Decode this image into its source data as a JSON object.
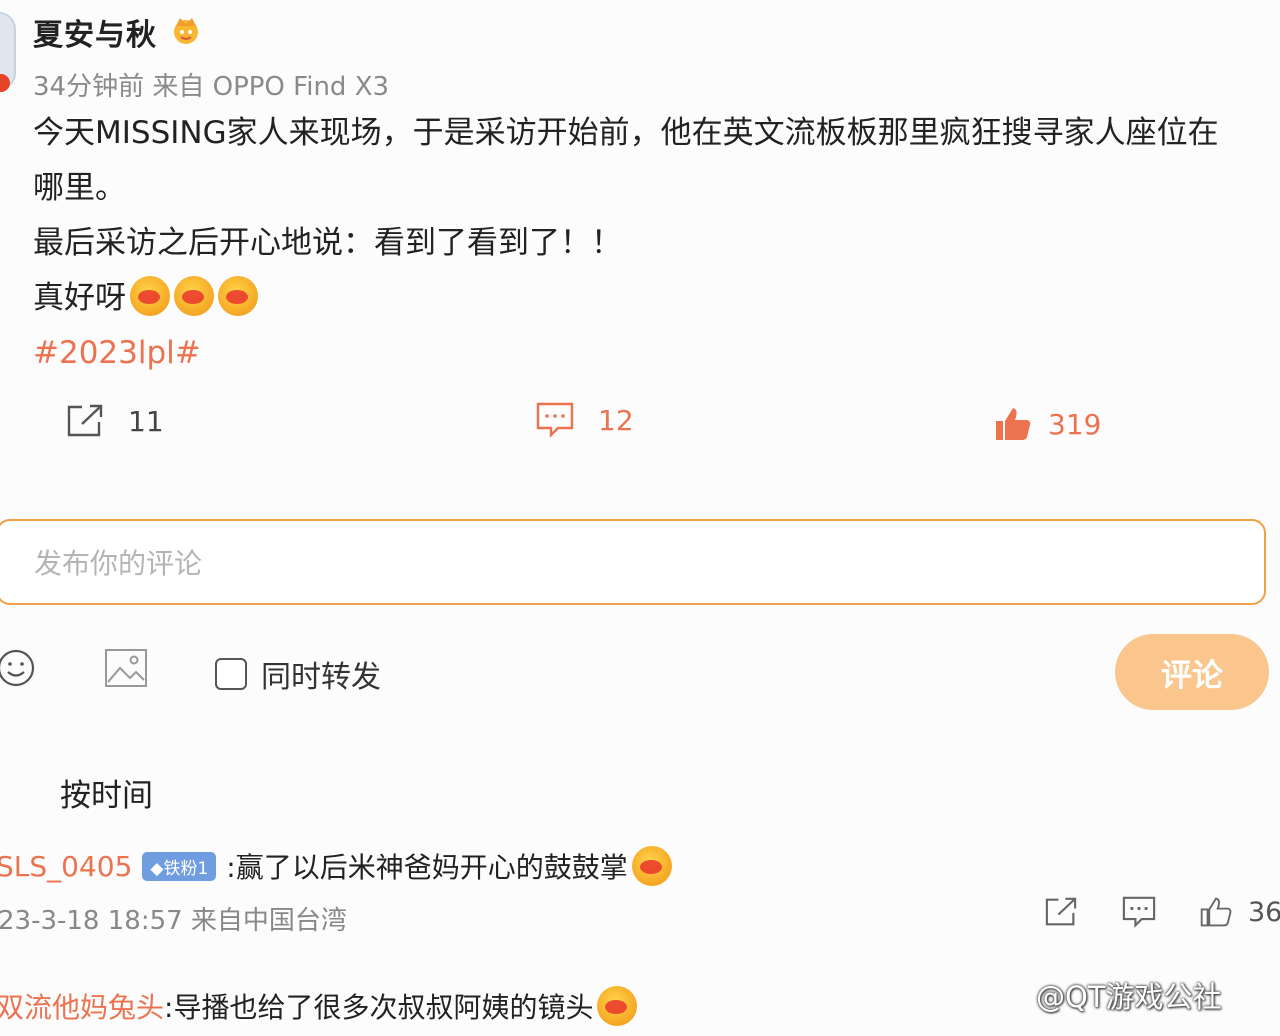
{
  "post": {
    "author": "夏安与秋",
    "meta": "34分钟前  来自 OPPO Find X3",
    "line1": "今天MISSING家人来现场，于是采访开始前，他在英文流板板那里疯狂搜寻家人座位在",
    "line2": "哪里。",
    "line3": "最后采访之后开心地说：看到了看到了！！",
    "line4": "真好呀",
    "hashtag": "#2023lpl#",
    "repost_count": "11",
    "comment_count": "12",
    "like_count": "319"
  },
  "composer": {
    "placeholder": "发布你的评论",
    "repost_label": "同时转发",
    "submit_label": "评论"
  },
  "sort": {
    "label": "按时间"
  },
  "comments": [
    {
      "user": "SLS_0405",
      "badge": "◆铁粉1",
      "text": ":赢了以后米神爸妈开心的鼓鼓掌",
      "meta": "23-3-18 18:57 来自中国台湾",
      "like_count": "36"
    },
    {
      "user": "双流他妈兔头",
      "text": ":导播也给了很多次叔叔阿姨的镜头"
    }
  ],
  "watermark": "@QT游戏公社",
  "colors": {
    "accent": "#eb7350",
    "input_border": "#f0a048",
    "submit_bg": "#fbc68d"
  }
}
